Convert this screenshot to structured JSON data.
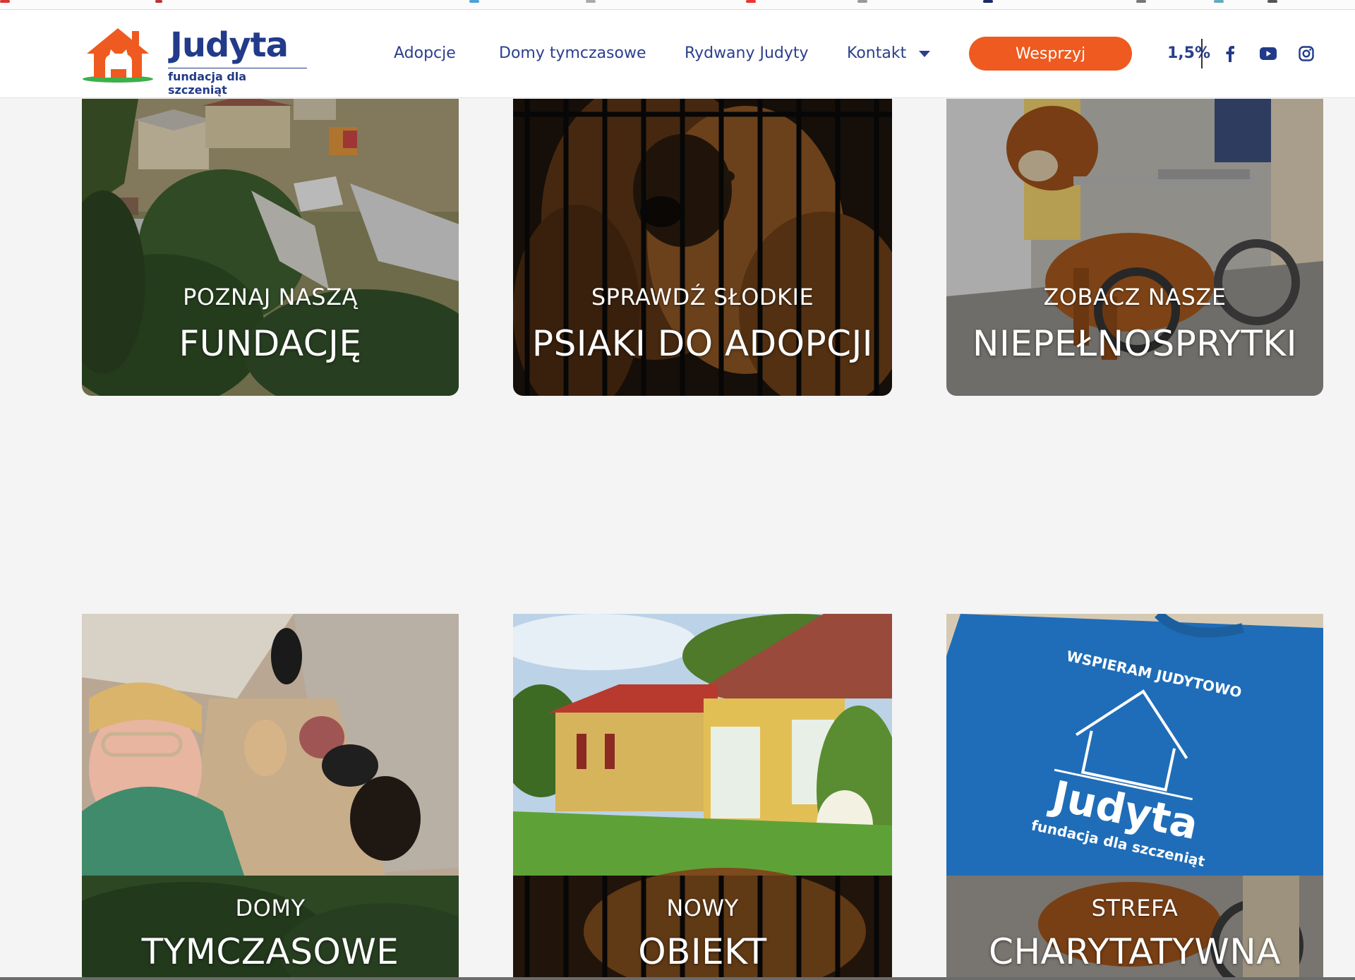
{
  "brand": {
    "title": "Judyta",
    "subtitle": "fundacja dla szczeniąt",
    "primary_color": "#223a8a",
    "accent_color": "#ee5a1f"
  },
  "nav": {
    "items": [
      {
        "label": "Adopcje"
      },
      {
        "label": "Domy tymczasowe"
      },
      {
        "label": "Rydwany Judyty"
      },
      {
        "label": "Kontakt"
      }
    ],
    "support_label": "Wesprzyj",
    "percent_label": "1,5%",
    "social": [
      "facebook-icon",
      "youtube-icon",
      "instagram-icon"
    ]
  },
  "tiles": [
    {
      "small": "POZNAJ NASZĄ",
      "big": "FUNDACJĘ"
    },
    {
      "small": "SPRAWDŹ SŁODKIE",
      "big": "PSIAKI DO ADOPCJI"
    },
    {
      "small": "ZOBACZ NASZE",
      "big": "NIEPEŁNOSPRYTKI"
    },
    {
      "small": "DOMY",
      "big": "TYMCZASOWE"
    },
    {
      "small": "NOWY",
      "big": "OBIEKT"
    },
    {
      "small": "STREFA",
      "big": "CHARYTATYWNA"
    }
  ],
  "tote": {
    "line1": "WSPIERAM JUDYTOWO",
    "line2": "Judyta",
    "line3": "fundacja dla szczeniąt"
  }
}
